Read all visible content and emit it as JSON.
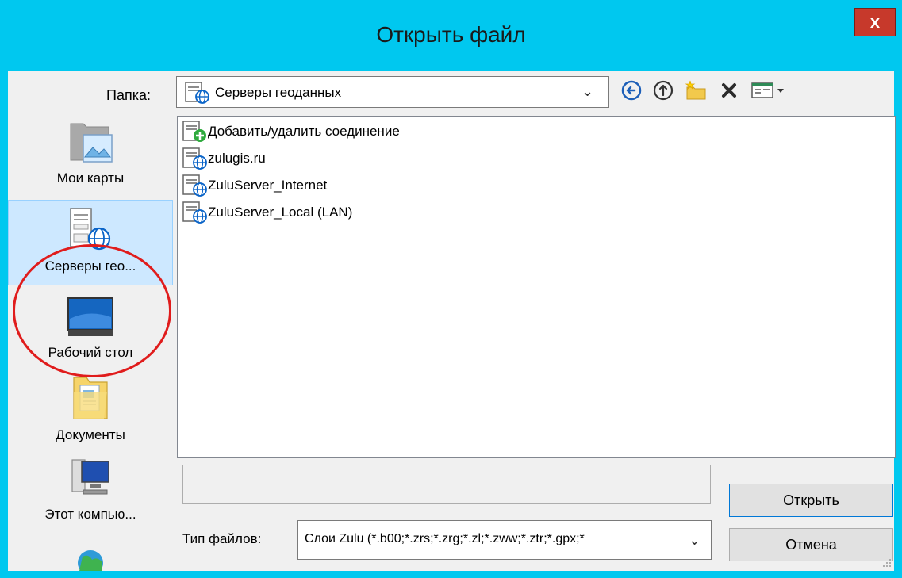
{
  "window": {
    "title": "Открыть файл",
    "close_label": "x"
  },
  "folder": {
    "label": "Папка:",
    "current": "Серверы геоданных",
    "current_icon": "geo-server-icon"
  },
  "toolbar": {
    "icons": [
      "back-arrow-icon",
      "up-arrow-icon",
      "new-folder-icon",
      "delete-icon",
      "view-menu-icon"
    ]
  },
  "places": [
    {
      "label": "Мои карты",
      "icon": "my-maps-folder-icon",
      "selected": false
    },
    {
      "label": "Серверы гео...",
      "icon": "geo-servers-icon",
      "selected": true
    },
    {
      "label": "Рабочий стол",
      "icon": "desktop-monitor-icon",
      "selected": false
    },
    {
      "label": "Документы",
      "icon": "documents-folder-icon",
      "selected": false
    },
    {
      "label": "Этот компью...",
      "icon": "computer-icon",
      "selected": false
    }
  ],
  "files": [
    {
      "name": "Добавить/удалить соединение",
      "icon": "add-connection-icon"
    },
    {
      "name": "zulugis.ru",
      "icon": "server-globe-icon"
    },
    {
      "name": "ZuluServer_Internet",
      "icon": "server-globe-icon"
    },
    {
      "name": "ZuluServer_Local (LAN)",
      "icon": "server-globe-icon"
    }
  ],
  "file_type": {
    "label": "Тип файлов:",
    "selected": "Слои Zulu (*.b00;*.zrs;*.zrg;*.zl;*.zww;*.ztr;*.gpx;*"
  },
  "buttons": {
    "open": "Открыть",
    "cancel": "Отмена"
  },
  "colors": {
    "title_bar": "#00c8ef",
    "close": "#c7392b",
    "selection": "#cde8ff",
    "annotation": "#e01c1c"
  }
}
